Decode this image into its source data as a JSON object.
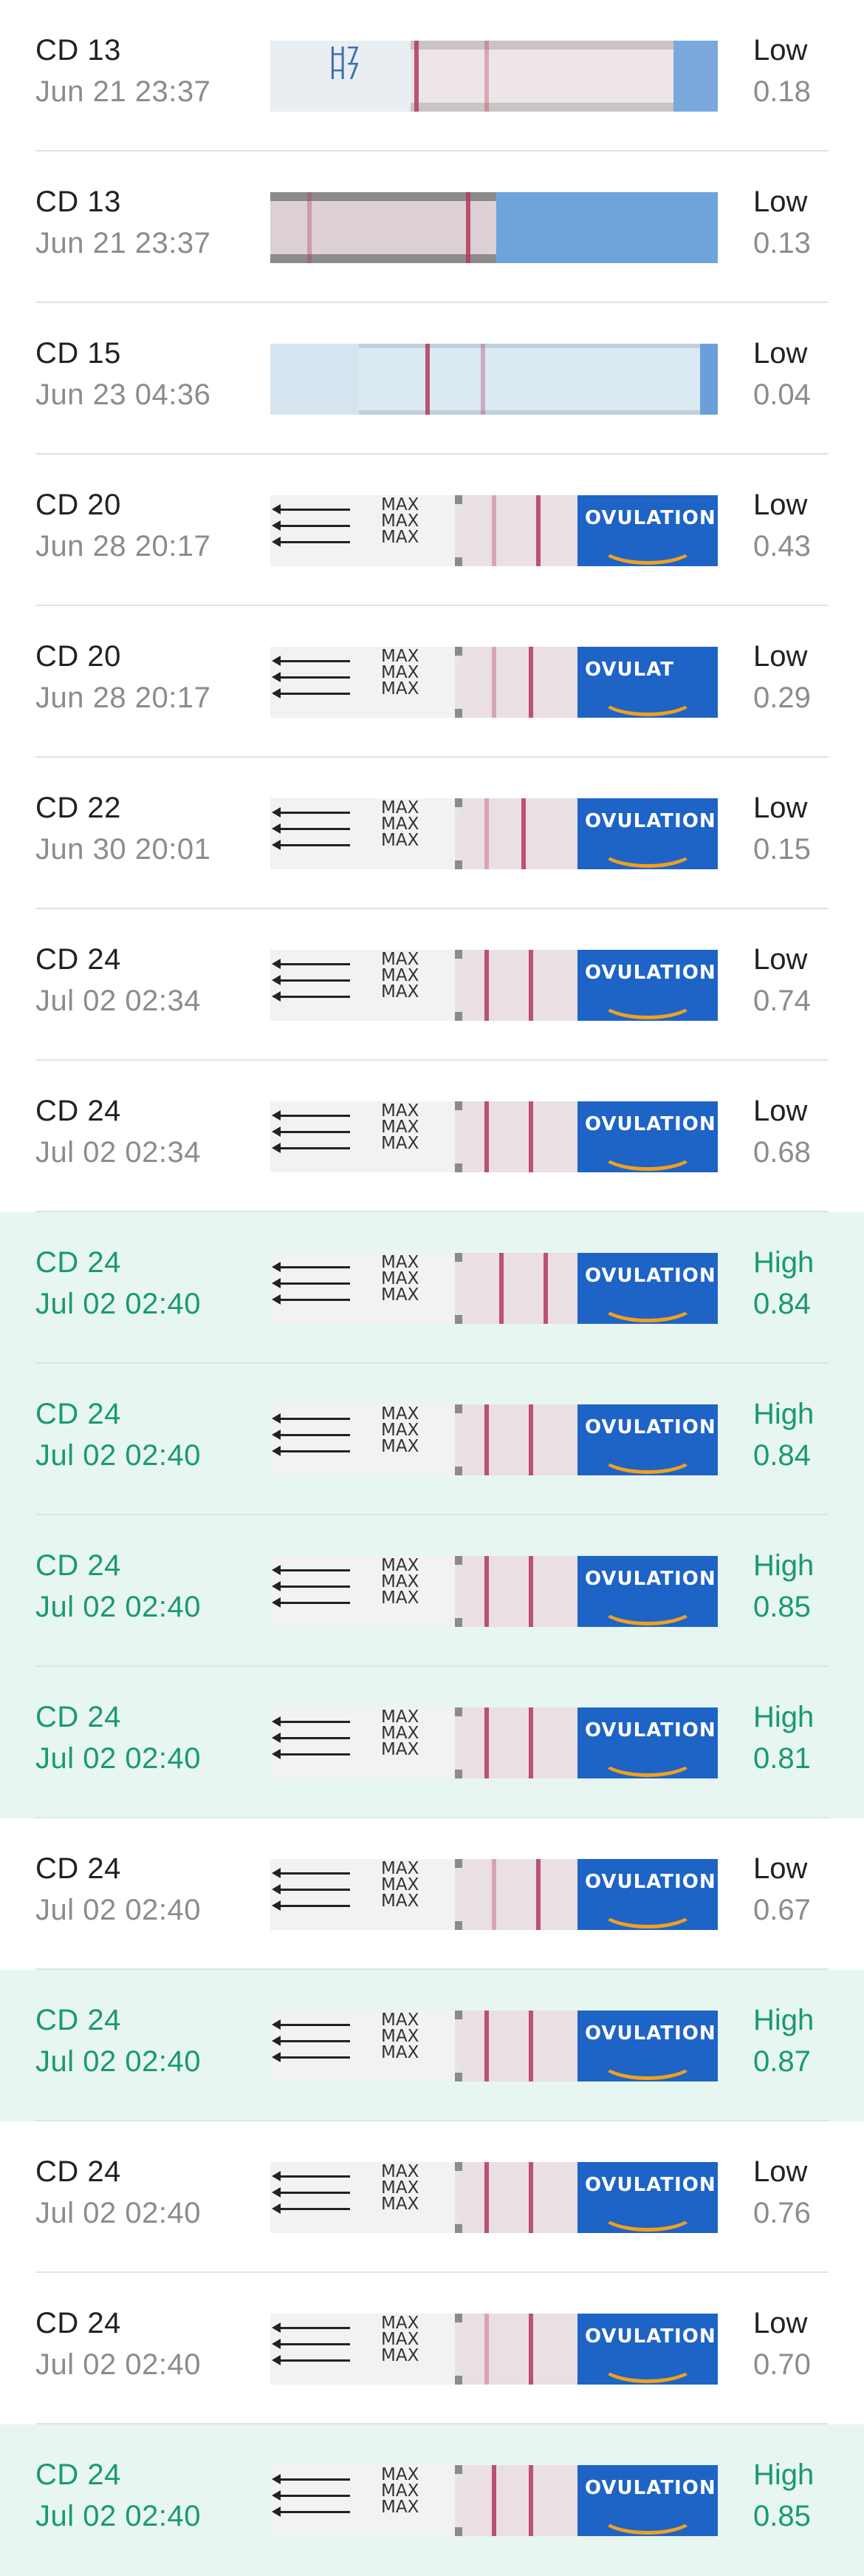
{
  "results": [
    {
      "cd": "CD 13",
      "date": "Jun 21 23:37",
      "level": "Low",
      "score": "0.18",
      "strip_text": "H7",
      "high": false
    },
    {
      "cd": "CD 13",
      "date": "Jun 21 23:37",
      "level": "Low",
      "score": "0.13",
      "strip_text": "",
      "high": false
    },
    {
      "cd": "CD 15",
      "date": "Jun 23 04:36",
      "level": "Low",
      "score": "0.04",
      "strip_text": "",
      "high": false
    },
    {
      "cd": "CD 20",
      "date": "Jun 28 20:17",
      "level": "Low",
      "score": "0.43",
      "strip_text": "MAX",
      "brand_text": "OVULATION",
      "high": false
    },
    {
      "cd": "CD 20",
      "date": "Jun 28 20:17",
      "level": "Low",
      "score": "0.29",
      "strip_text": "MAX",
      "brand_text": "OVULAT",
      "high": false
    },
    {
      "cd": "CD 22",
      "date": "Jun 30 20:01",
      "level": "Low",
      "score": "0.15",
      "strip_text": "MAX",
      "brand_text": "OVULATION",
      "high": false
    },
    {
      "cd": "CD 24",
      "date": "Jul 02 02:34",
      "level": "Low",
      "score": "0.74",
      "strip_text": "MAX",
      "brand_text": "OVULATION",
      "high": false
    },
    {
      "cd": "CD 24",
      "date": "Jul 02 02:34",
      "level": "Low",
      "score": "0.68",
      "strip_text": "MAX",
      "brand_text": "OVULATION",
      "high": false
    },
    {
      "cd": "CD 24",
      "date": "Jul 02 02:40",
      "level": "High",
      "score": "0.84",
      "strip_text": "MAX",
      "brand_text": "OVULATION",
      "high": true
    },
    {
      "cd": "CD 24",
      "date": "Jul 02 02:40",
      "level": "High",
      "score": "0.84",
      "strip_text": "MAX",
      "brand_text": "OVULATION",
      "high": true
    },
    {
      "cd": "CD 24",
      "date": "Jul 02 02:40",
      "level": "High",
      "score": "0.85",
      "strip_text": "MAX",
      "brand_text": "OVULATION",
      "high": true
    },
    {
      "cd": "CD 24",
      "date": "Jul 02 02:40",
      "level": "High",
      "score": "0.81",
      "strip_text": "MAX",
      "brand_text": "OVULATION",
      "high": true
    },
    {
      "cd": "CD 24",
      "date": "Jul 02 02:40",
      "level": "Low",
      "score": "0.67",
      "strip_text": "MAX",
      "brand_text": "OVULATION",
      "high": false
    },
    {
      "cd": "CD 24",
      "date": "Jul 02 02:40",
      "level": "High",
      "score": "0.87",
      "strip_text": "MAX",
      "brand_text": "OVULATION",
      "high": true
    },
    {
      "cd": "CD 24",
      "date": "Jul 02 02:40",
      "level": "Low",
      "score": "0.76",
      "strip_text": "MAX",
      "brand_text": "OVULATION",
      "high": false
    },
    {
      "cd": "CD 24",
      "date": "Jul 02 02:40",
      "level": "Low",
      "score": "0.70",
      "strip_text": "MAX",
      "brand_text": "OVULATION",
      "high": false
    },
    {
      "cd": "CD 24",
      "date": "Jul 02 02:40",
      "level": "High",
      "score": "0.85",
      "strip_text": "MAX",
      "brand_text": "OVULATION",
      "high": true
    }
  ],
  "colors": {
    "high_text": "#1a9a6e",
    "high_background": "#e7f6f0",
    "low_label": "#222222",
    "secondary_text": "#8c8c8c"
  }
}
